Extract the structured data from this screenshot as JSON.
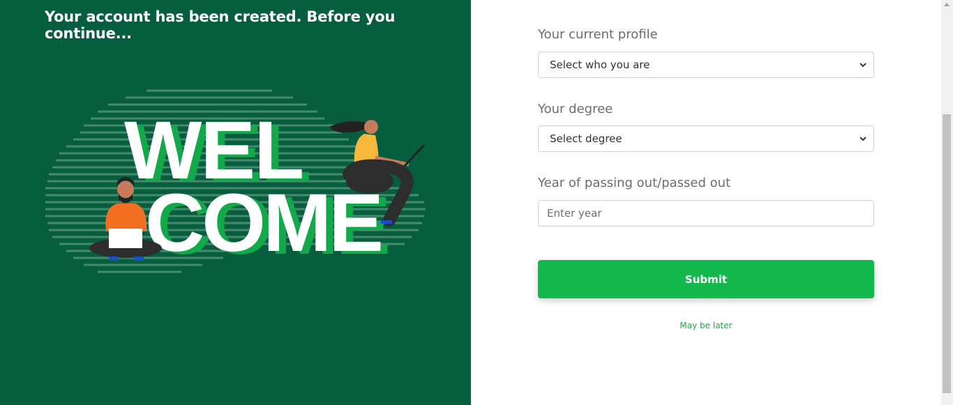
{
  "left": {
    "title": "Your account has been created. Before you continue...",
    "illustration": {
      "line1": "WEL",
      "line2": "COME"
    }
  },
  "form": {
    "profile": {
      "label": "Your current profile",
      "selected": "Select who you are"
    },
    "degree": {
      "label": "Your degree",
      "selected": "Select degree"
    },
    "year": {
      "label": "Year of passing out/passed out",
      "placeholder": "Enter year",
      "value": ""
    },
    "submit_label": "Submit",
    "later_label": "May be later"
  },
  "colors": {
    "left_bg": "#075e3f",
    "accent_green": "#13b94c",
    "link_green": "#2e9e4a"
  },
  "icons": {
    "select_arrow": "chevron-down-icon"
  }
}
